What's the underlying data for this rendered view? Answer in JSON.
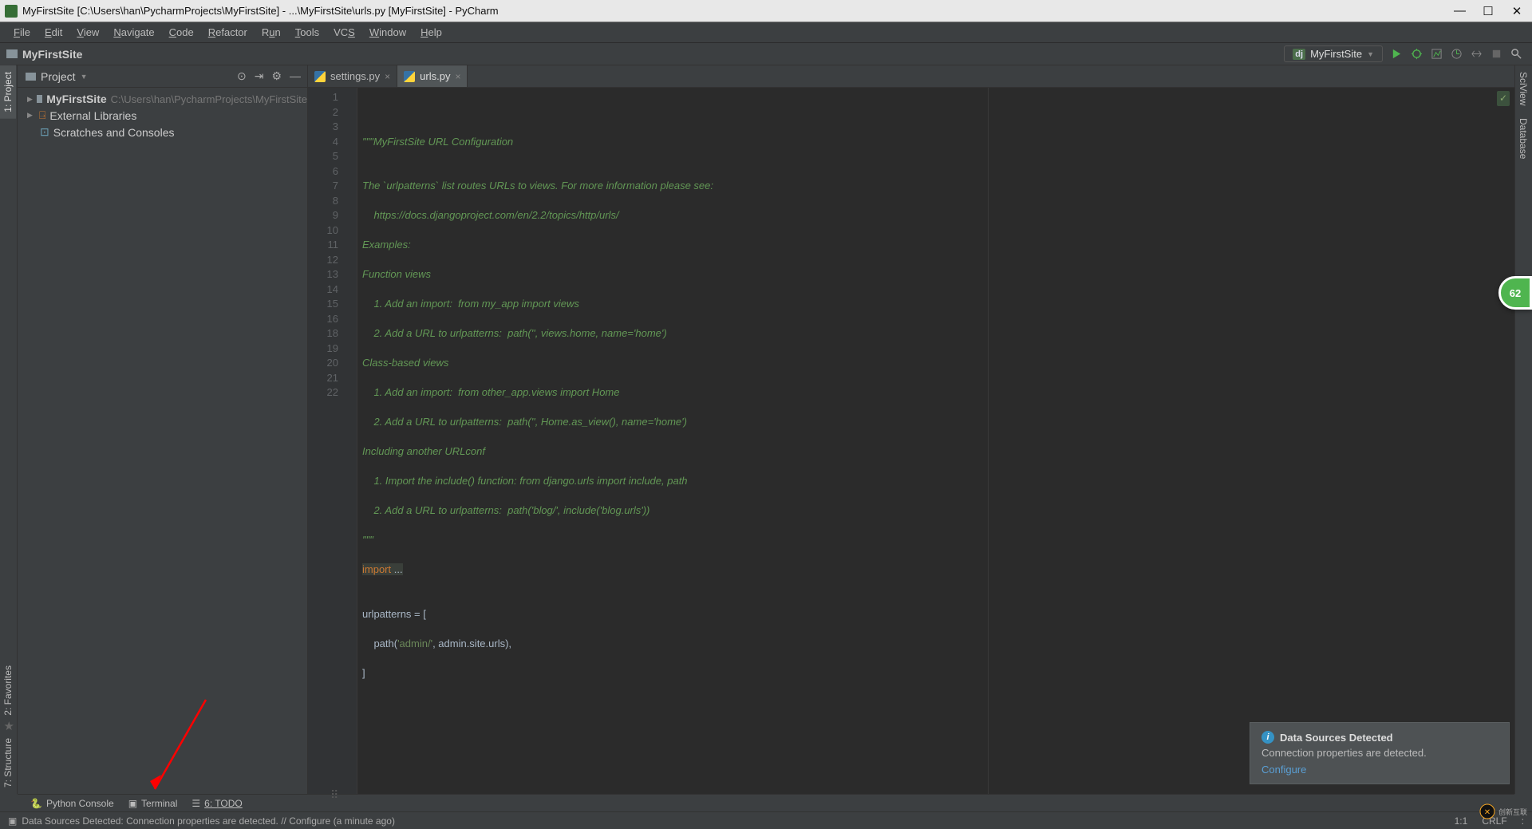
{
  "titlebar": {
    "text": "MyFirstSite [C:\\Users\\han\\PycharmProjects\\MyFirstSite] - ...\\MyFirstSite\\urls.py [MyFirstSite] - PyCharm"
  },
  "menu": {
    "file": "File",
    "edit": "Edit",
    "view": "View",
    "navigate": "Navigate",
    "code": "Code",
    "refactor": "Refactor",
    "run": "Run",
    "tools": "Tools",
    "vcs": "VCS",
    "window": "Window",
    "help": "Help"
  },
  "nav": {
    "crumb": "MyFirstSite",
    "runconfig": "MyFirstSite"
  },
  "left_tabs": {
    "project": "1: Project",
    "structure": "7: Structure",
    "favorites": "2: Favorites"
  },
  "right_tabs": {
    "sciview": "SciView",
    "database": "Database"
  },
  "project_panel": {
    "title": "Project",
    "root": {
      "name": "MyFirstSite",
      "path": "C:\\Users\\han\\PycharmProjects\\MyFirstSite"
    },
    "ext": "External Libraries",
    "scratches": "Scratches and Consoles"
  },
  "tabs": [
    {
      "name": "settings.py",
      "active": false
    },
    {
      "name": "urls.py",
      "active": true
    }
  ],
  "code_lines": {
    "l1": "\"\"\"MyFirstSite URL Configuration",
    "l2": "",
    "l3": "The `urlpatterns` list routes URLs to views. For more information please see:",
    "l4": "    https://docs.djangoproject.com/en/2.2/topics/http/urls/",
    "l5": "Examples:",
    "l6": "Function views",
    "l7": "    1. Add an import:  from my_app import views",
    "l8": "    2. Add a URL to urlpatterns:  path('', views.home, name='home')",
    "l9": "Class-based views",
    "l10": "    1. Add an import:  from other_app.views import Home",
    "l11": "    2. Add a URL to urlpatterns:  path('', Home.as_view(), name='home')",
    "l12": "Including another URLconf",
    "l13": "    1. Import the include() function: from django.urls import include, path",
    "l14": "    2. Add a URL to urlpatterns:  path('blog/', include('blog.urls'))",
    "l15": "\"\"\"",
    "l16a": "import ",
    "l16b": "...",
    "l18": "",
    "l19": "urlpatterns = [",
    "l20a": "    path(",
    "l20b": "'admin/'",
    "l20c": ", admin.site.urls),",
    "l21": "]"
  },
  "line_numbers": [
    "1",
    "2",
    "3",
    "4",
    "5",
    "6",
    "7",
    "8",
    "9",
    "10",
    "11",
    "12",
    "13",
    "14",
    "15",
    "16",
    "18",
    "19",
    "20",
    "21",
    "22"
  ],
  "notif": {
    "title": "Data Sources Detected",
    "body": "Connection properties are detected.",
    "link": "Configure"
  },
  "bottom": {
    "python_console": "Python Console",
    "terminal": "Terminal",
    "todo": "6: TODO"
  },
  "status": {
    "msg": "Data Sources Detected: Connection properties are detected. // Configure (a minute ago)",
    "pos": "1:1",
    "enc": "CRLF"
  },
  "badge": "62",
  "watermark": "创新互联"
}
